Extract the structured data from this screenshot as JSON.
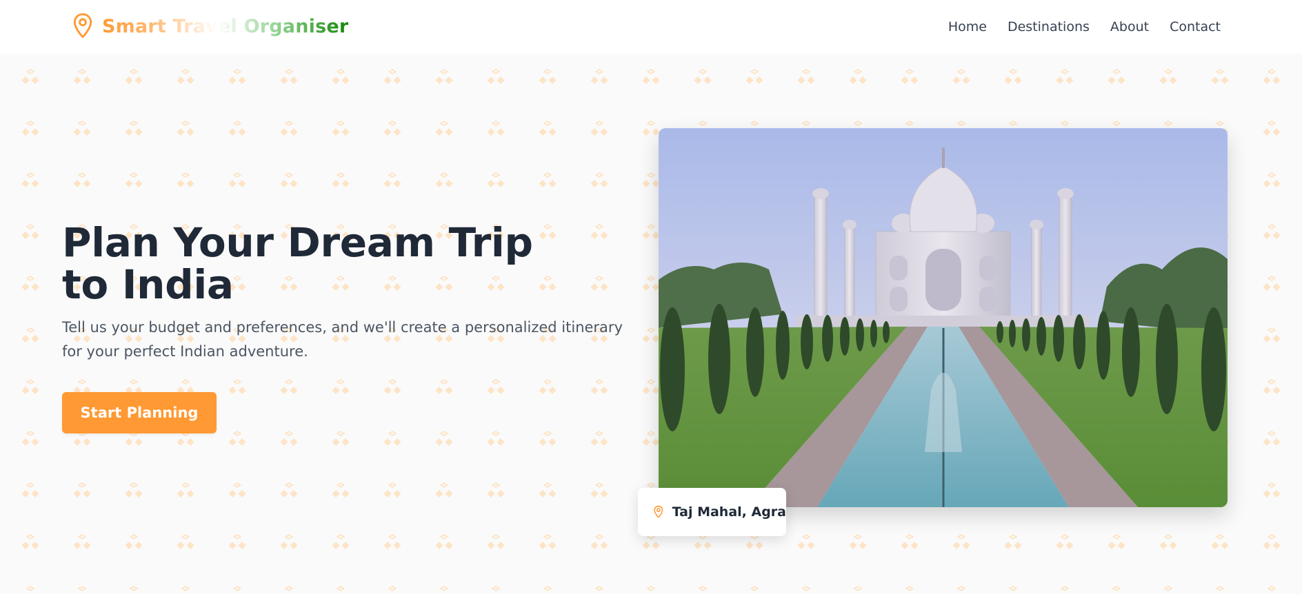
{
  "brand": {
    "name": "Smart Travel Organiser",
    "icon": "map-pin-icon"
  },
  "nav": {
    "items": [
      {
        "label": "Home"
      },
      {
        "label": "Destinations"
      },
      {
        "label": "About"
      },
      {
        "label": "Contact"
      }
    ]
  },
  "hero": {
    "headline": "Plan Your Dream Trip to India",
    "subtitle": "Tell us your budget and preferences, and we'll create a personalized itinerary for your perfect Indian adventure.",
    "cta_label": "Start Planning",
    "image_alt": "Taj Mahal",
    "caption": {
      "icon": "map-pin-icon",
      "label": "Taj Mahal, Agra"
    }
  },
  "colors": {
    "saffron": "#ff9933",
    "green": "#138808",
    "heading": "#1f2937",
    "body_text": "#4b5563",
    "nav_text": "#374151",
    "background": "#fafafa"
  }
}
